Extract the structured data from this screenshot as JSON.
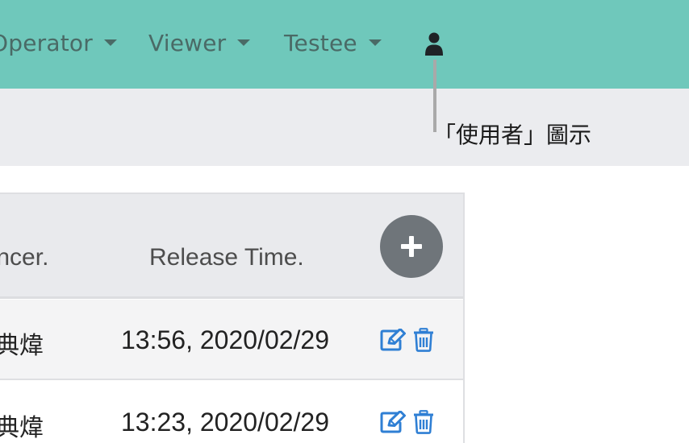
{
  "navbar": {
    "items": [
      {
        "label": "Operator"
      },
      {
        "label": "Viewer"
      },
      {
        "label": "Testee"
      }
    ],
    "user_icon": "user-icon",
    "background": "#6fc8bb"
  },
  "annotation": {
    "label": "「使用者」圖示"
  },
  "table": {
    "headers": {
      "announcer": "ouncer.",
      "release_time": "Release Time."
    },
    "add_icon": "plus-icon",
    "rows": [
      {
        "name": "典煒",
        "time": "13:56, 2020/02/29"
      },
      {
        "name": "典煒",
        "time": "13:23, 2020/02/29"
      }
    ],
    "row_actions": [
      "edit-icon",
      "trash-icon"
    ],
    "accent": "#2f7fd4",
    "add_button_color": "#6f757a"
  }
}
